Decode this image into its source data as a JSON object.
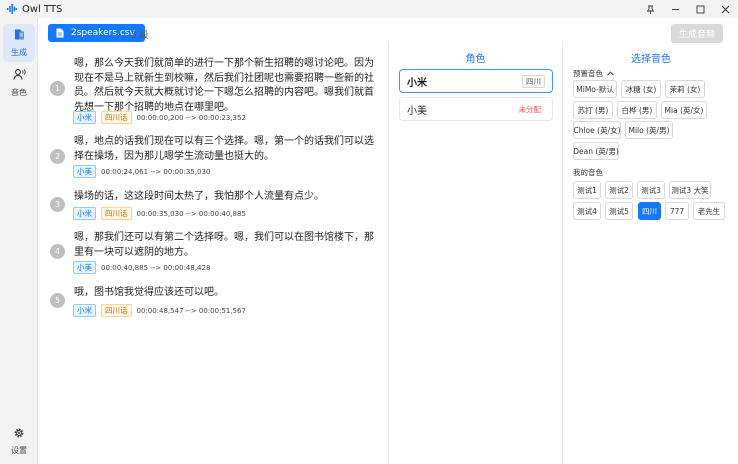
{
  "app": {
    "title": "Owl TTS"
  },
  "sidebar": {
    "items": [
      {
        "label": "生成",
        "icon": "document-icon"
      },
      {
        "label": "音色",
        "icon": "user-voice-icon"
      },
      {
        "label": "设置",
        "icon": "gear-icon"
      }
    ]
  },
  "toolbar": {
    "file_name": "2speakers.csv",
    "segment_count": "5 段",
    "generate_label": "生成音频"
  },
  "segments": [
    {
      "num": "1",
      "text": "嗯，那么今天我们就简单的进行一下那个新生招聘的嗯讨论吧。因为现在不是马上就新生到校嘛，然后我们社团呢也需要招聘一些新的社员。然后就今天就大概就讨论一下嗯怎么招聘的内容吧。嗯我们就首先想一下那个招聘的地点在哪里吧。",
      "speaker": "小米",
      "dialect": "四川话",
      "time": "00:00:00,200 --> 00:00:23,352"
    },
    {
      "num": "2",
      "text": "嗯，地点的话我们现在可以有三个选择。嗯，第一个的话我们可以选择在操场，因为那儿嗯学生流动量也挺大的。",
      "speaker": "小美",
      "dialect": "",
      "time": "00:00:24,061 --> 00:00:35,030"
    },
    {
      "num": "3",
      "text": "操场的话，这这段时间太热了，我怕那个人流量有点少。",
      "speaker": "小米",
      "dialect": "四川话",
      "time": "00:00:35,030 --> 00:00:40,885"
    },
    {
      "num": "4",
      "text": "嗯，那我们还可以有第二个选择呀。嗯，我们可以在图书馆楼下，那里有一块可以遮阴的地方。",
      "speaker": "小美",
      "dialect": "",
      "time": "00:00:40,885 --> 00:00:48,428"
    },
    {
      "num": "5",
      "text": "哦，图书馆我觉得应该还可以吧。",
      "speaker": "小米",
      "dialect": "四川话",
      "time": "00:00:48,547 --> 00:00:51,567"
    }
  ],
  "roles": {
    "title": "角色",
    "items": [
      {
        "name": "小米",
        "tag": "四川"
      },
      {
        "name": "小美",
        "tag": "未分配"
      }
    ]
  },
  "voices": {
    "title": "选择音色",
    "preset_label": "预置音色",
    "preset": [
      "MiMo-默认",
      "冰糖 (女)",
      "茉莉 (女)",
      "苏打 (男)",
      "白桦 (男)",
      "Mia (英/女)",
      "Chloe (英/女)",
      "Milo (英/男)",
      "Dean (英/男)"
    ],
    "mine_label": "我的音色",
    "mine": [
      "测试1",
      "测试2",
      "测试3",
      "测试3 大笑",
      "测试4",
      "测试5",
      "四川",
      "777",
      "老先生"
    ],
    "active": "四川"
  },
  "colors": {
    "accent": "#1677ff",
    "active_bg": "#dde9f8"
  }
}
